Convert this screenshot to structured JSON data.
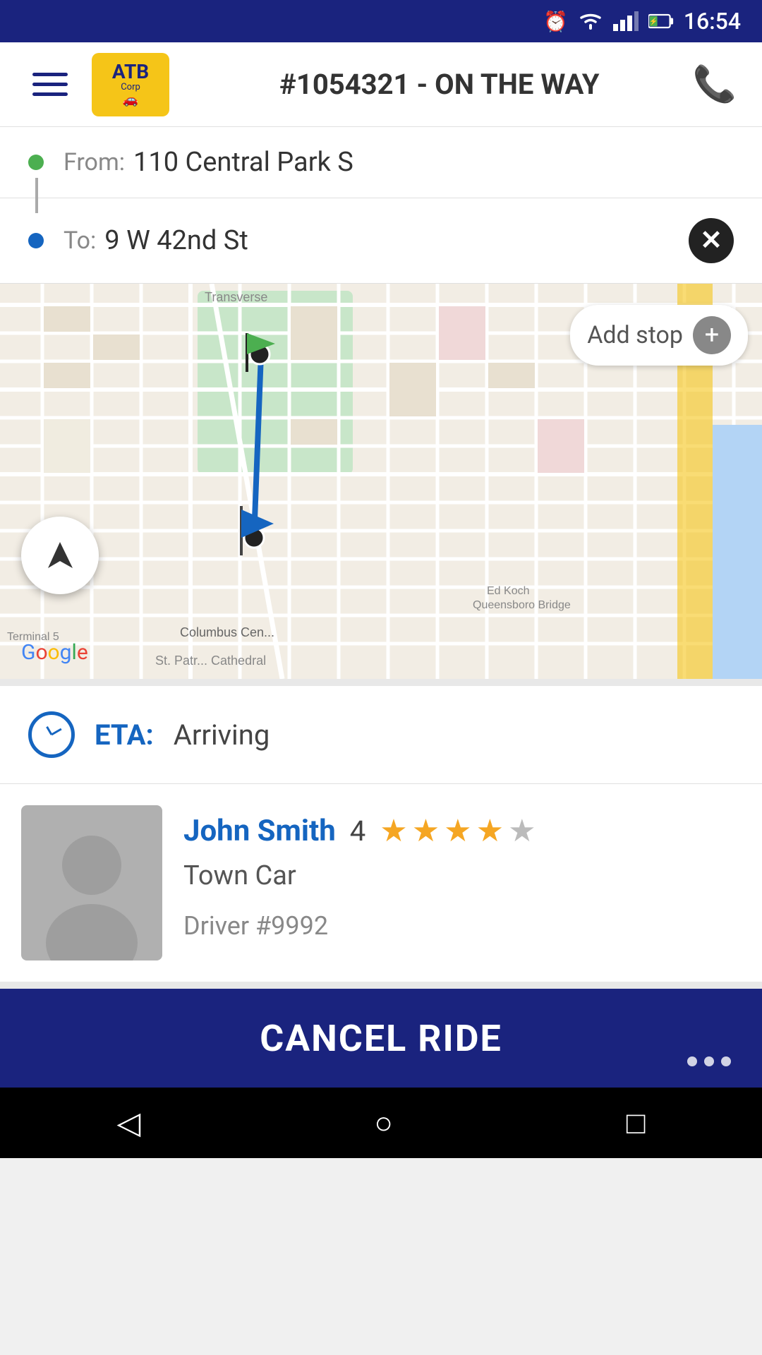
{
  "status_bar": {
    "time": "16:54",
    "icons": [
      "alarm",
      "wifi",
      "signal",
      "battery"
    ]
  },
  "top_nav": {
    "logo_line1": "ATB",
    "logo_line2": "Corp",
    "title": "#1054321 - ON THE WAY"
  },
  "route": {
    "from_label": "From:",
    "from_address": "110 Central Park S",
    "to_label": "To:",
    "to_address": "9 W 42nd St",
    "add_stop_label": "Add stop"
  },
  "eta": {
    "label": "ETA:",
    "value": "Arriving"
  },
  "driver": {
    "name": "John Smith",
    "rating_number": "4",
    "vehicle": "Town Car",
    "driver_id": "Driver #9992",
    "stars_filled": 4,
    "stars_total": 5
  },
  "cancel_btn": {
    "label": "CANCEL RIDE"
  },
  "bottom_nav": {
    "back_icon": "◁",
    "home_icon": "○",
    "recents_icon": "□"
  }
}
